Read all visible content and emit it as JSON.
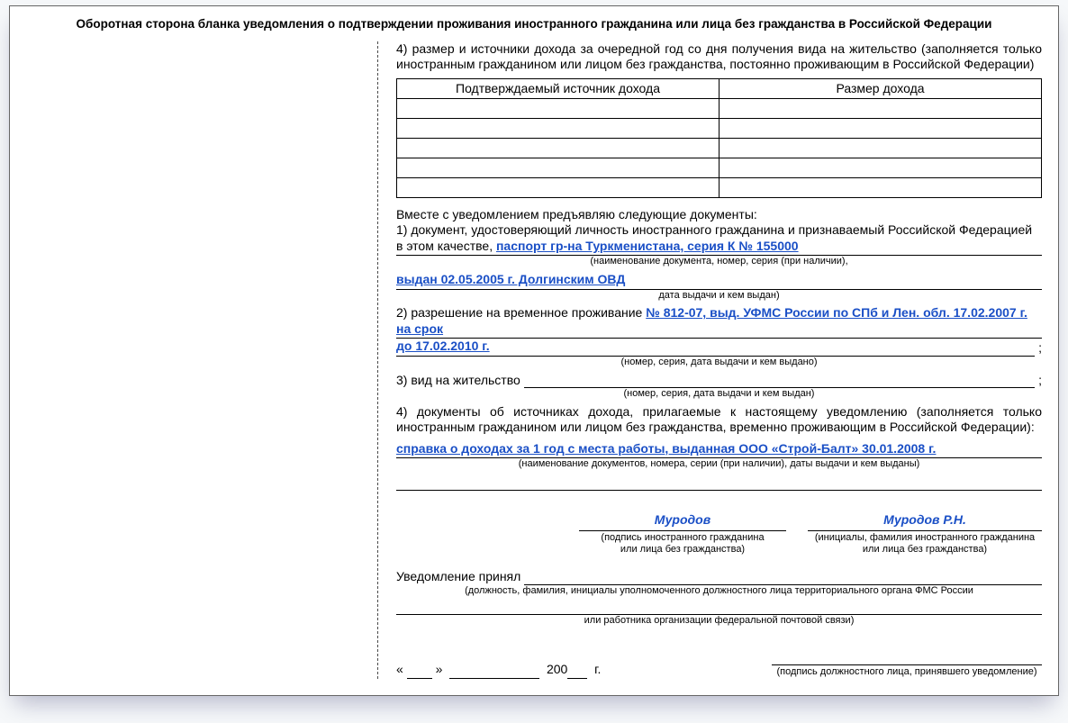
{
  "title": "Оборотная сторона бланка уведомления о подтверждении проживания иностранного гражданина или лица без гражданства в Российской Федерации",
  "section4": "4) размер и источники дохода за очередной год со дня получения вида на жительство (заполняется только иностранным гражданином или лицом без гражданства, постоянно проживающим в Российской Федерации)",
  "table": {
    "col1": "Подтверждаемый источник дохода",
    "col2": "Размер дохода"
  },
  "attach_intro": "Вместе с уведомлением предъявляю следующие документы:",
  "item1": {
    "prefix": "1) документ, удостоверяющий личность иностранного гражданина и признаваемый Российской Федерацией в этом качестве, ",
    "value": "паспорт гр-на Туркменистана, серия К № 155000",
    "hint1": "(наименование документа, номер, серия (при наличии),",
    "issued": "выдан  02.05.2005 г. Долгинским ОВД",
    "hint2": "дата выдачи и кем выдан)"
  },
  "item2": {
    "prefix": "2) разрешение на временное проживание ",
    "value1": "№ 812-07, выд. УФМС России по СПб и Лен. обл. 17.02.2007 г. на срок",
    "value2": "до 17.02.2010 г.",
    "hint": "(номер, серия, дата выдачи и кем выдано)"
  },
  "item3": {
    "prefix": "3) вид на жительство",
    "hint": "(номер, серия, дата выдачи и кем выдан)"
  },
  "item4": {
    "para": "4) документы об источниках дохода, прилагаемые к настоящему уведомлению (заполняется только иностранным гражданином или лицом без гражданства, временно проживающим в Российской Федерации):",
    "value": "справка о доходах за 1 год с места работы, выданная ООО «Строй-Балт» 30.01.2008 г.",
    "hint": "(наименование документов, номера, серии (при наличии), даты выдачи и кем выданы)"
  },
  "sig": {
    "left_val": "Муродов",
    "left_hint": "(подпись иностранного гражданина\nили лица без гражданства)",
    "right_val": "Муродов Р.Н.",
    "right_hint": "(инициалы, фамилия иностранного гражданина\nили лица без гражданства)"
  },
  "accept": {
    "label": "Уведомление принял",
    "hint1": "(должность, фамилия, инициалы уполномоченного должностного лица территориального органа ФМС России",
    "hint2": "или работника организации федеральной почтовой связи)"
  },
  "date": {
    "open": "«",
    "close": "»",
    "year_prefix": "200",
    "year_suffix": "г."
  },
  "official_hint": "(подпись должностного лица, принявшего уведомление)"
}
